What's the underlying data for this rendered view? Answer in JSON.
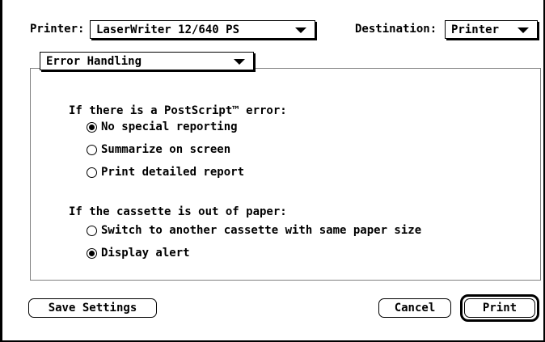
{
  "header": {
    "printer_label": "Printer:",
    "printer_value": "LaserWriter 12/640 PS",
    "destination_label": "Destination:",
    "destination_value": "Printer"
  },
  "section_popup": {
    "value": "Error Handling"
  },
  "postscript_error": {
    "heading": "If there is a PostScript™ error:",
    "options": [
      {
        "label": "No special reporting",
        "selected": true
      },
      {
        "label": "Summarize on screen",
        "selected": false
      },
      {
        "label": "Print detailed report",
        "selected": false
      }
    ]
  },
  "cassette": {
    "heading": "If the cassette is out of paper:",
    "options": [
      {
        "label": "Switch to another cassette with same paper size",
        "selected": false
      },
      {
        "label": "Display alert",
        "selected": true
      }
    ]
  },
  "buttons": {
    "save_settings": "Save Settings",
    "cancel": "Cancel",
    "print": "Print"
  }
}
